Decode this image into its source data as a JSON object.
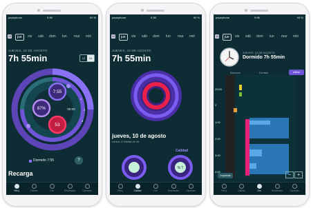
{
  "status": {
    "carrier": "pepephone",
    "carrier_short": "pepephone",
    "time": "9:36",
    "battery": "92 %",
    "battery_b": "93 %"
  },
  "days": {
    "calendar_icon_text": "15",
    "items": [
      "jue",
      "vie",
      "sáb",
      "dom",
      "lun",
      "mar",
      "mié"
    ]
  },
  "screen1": {
    "date": "JUEVES, 10 DE AGOSTO",
    "duration": "7h 55min",
    "seg_12": "12",
    "seg_24": "24",
    "rings": {
      "inner_top": "7:55",
      "inner_left": "87%",
      "inner_bottom": "53",
      "center_time": "00:00"
    },
    "ticks": [
      "1",
      "2",
      "3"
    ],
    "legend": "Dormido 7:55",
    "help": "?",
    "section": "Recarga"
  },
  "screen2": {
    "date": "JUEVES, 10 DE AGOSTO",
    "duration": "7h 55min",
    "day_title": "jueves, 10 de agosto",
    "day_sub": "versus ⊙ Media de 16",
    "quality_label": "Calidad",
    "gauge_right": "% T"
  },
  "screen3": {
    "date": "JUEVES, 10 DE AGOSTO",
    "title": "Dormido 7h 55min",
    "edit": "editar",
    "col_sensors": "Sensores",
    "col_sleep": "Dormido",
    "times": [
      "23:00",
      "0",
      "1:00",
      "2:00",
      "3:00",
      "4:00"
    ],
    "legend_btn": "Leyenda",
    "zoom_out": "−",
    "zoom_in": "+"
  },
  "tabs": [
    {
      "label": "Reloj"
    },
    {
      "label": "Calidad"
    },
    {
      "label": "Día"
    },
    {
      "label": "Resultados"
    },
    {
      "label": "Opciones"
    }
  ],
  "colors": {
    "bg": "#0e2c33",
    "purple": "#7b5cf0",
    "red": "#e8204a",
    "blue": "#3d8fd6",
    "pink": "#e8207a"
  }
}
